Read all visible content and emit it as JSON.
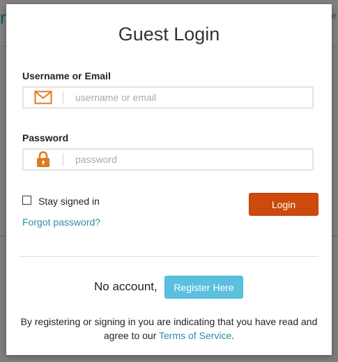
{
  "background": {
    "logo_fragment": "r",
    "link_fragment": "e"
  },
  "modal": {
    "title": "Guest Login",
    "username": {
      "label": "Username or Email",
      "placeholder": "username or email",
      "value": "",
      "icon": "envelope-icon"
    },
    "password": {
      "label": "Password",
      "placeholder": "password",
      "value": "",
      "icon": "lock-icon"
    },
    "stay_signed_in": {
      "label": "Stay signed in",
      "checked": false
    },
    "login_label": "Login",
    "forgot_label": "Forgot password?",
    "no_account_text": "No account,",
    "register_label": "Register Here",
    "legal_text": "By registering or signing in you are indicating that you have read and agree to our ",
    "terms_label": "Terms of Service",
    "legal_end": "."
  },
  "colors": {
    "accent_orange": "#cc4a0c",
    "register_blue": "#5bc0de",
    "link_blue": "#2a8ea6",
    "icon_orange": "#e07b1a"
  }
}
